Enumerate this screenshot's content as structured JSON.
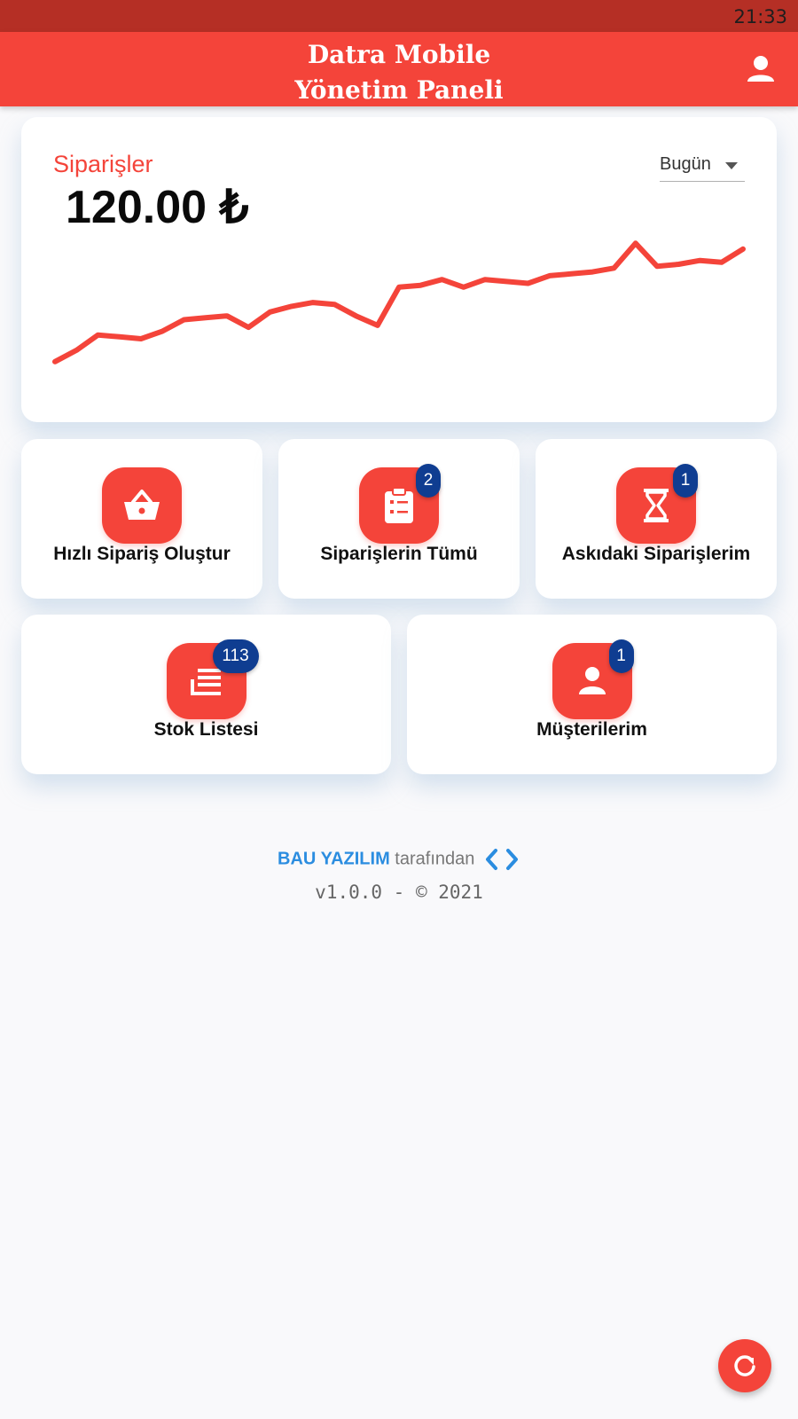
{
  "status_bar": {
    "time": "21:33"
  },
  "app_bar": {
    "title_line1": "Datra Mobile",
    "title_line2": "Yönetim Paneli",
    "profile_icon": "person-icon"
  },
  "orders_card": {
    "title": "Siparişler",
    "total": "120.00 ₺",
    "period": "Bugün"
  },
  "chart_data": {
    "type": "line",
    "title": "",
    "xlabel": "",
    "ylabel": "",
    "color": "#f4443a",
    "grid": false,
    "axes_visible": false,
    "values": [
      16,
      22,
      30,
      29,
      28,
      32,
      38,
      39,
      40,
      34,
      42,
      45,
      47,
      46,
      40,
      35,
      55,
      56,
      59,
      55,
      59,
      58,
      57,
      61,
      62,
      63,
      65,
      78,
      66,
      67,
      69,
      68,
      75
    ]
  },
  "tiles": [
    {
      "label": "Hızlı Sipariş Oluştur",
      "icon": "basket-icon"
    },
    {
      "label": "Siparişlerin Tümü",
      "icon": "clipboard-list-icon",
      "badge": "2"
    },
    {
      "label": "Askıdaki Siparişlerim",
      "icon": "hourglass-icon",
      "badge": "1"
    },
    {
      "label": "Stok Listesi",
      "icon": "stack-icon",
      "badge": "113"
    },
    {
      "label": "Müşterilerim",
      "icon": "person-icon",
      "badge": "1"
    }
  ],
  "footer": {
    "brand": "BAU YAZILIM",
    "by": "tarafından",
    "version": "v1.0.0 - © 2021"
  },
  "colors": {
    "primary": "#f4443a",
    "status_bar": "#b52f25",
    "badge": "#0f3d91",
    "link": "#2b8de0"
  },
  "fab": {
    "icon": "refresh-icon"
  }
}
